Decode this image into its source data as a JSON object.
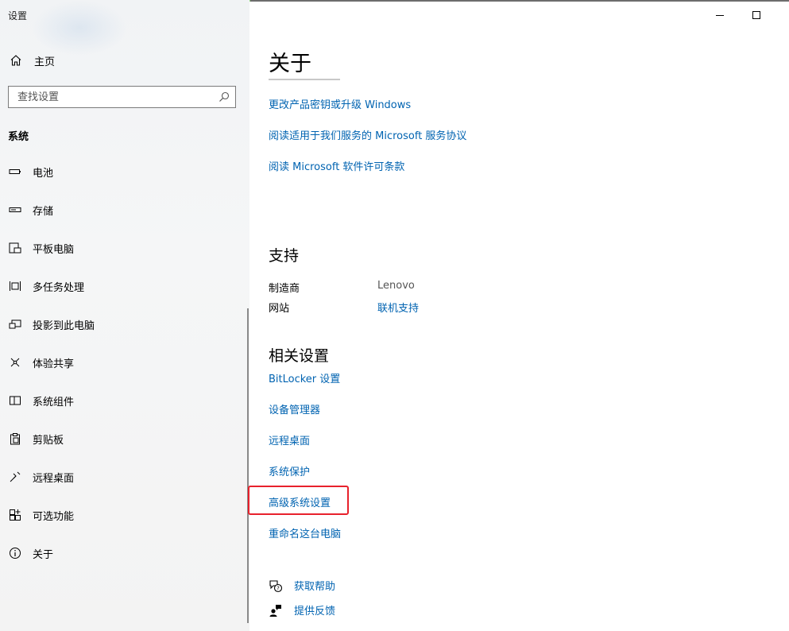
{
  "window": {
    "title": "设置"
  },
  "sidebar": {
    "home_label": "主页",
    "search_placeholder": "查找设置",
    "section_label": "系统",
    "items": [
      {
        "label": "电池",
        "icon": "battery-icon"
      },
      {
        "label": "存储",
        "icon": "storage-icon"
      },
      {
        "label": "平板电脑",
        "icon": "tablet-icon"
      },
      {
        "label": "多任务处理",
        "icon": "multitasking-icon"
      },
      {
        "label": "投影到此电脑",
        "icon": "project-icon"
      },
      {
        "label": "体验共享",
        "icon": "shared-experiences-icon"
      },
      {
        "label": "系统组件",
        "icon": "system-components-icon"
      },
      {
        "label": "剪贴板",
        "icon": "clipboard-icon"
      },
      {
        "label": "远程桌面",
        "icon": "remote-desktop-icon"
      },
      {
        "label": "可选功能",
        "icon": "optional-features-icon"
      },
      {
        "label": "关于",
        "icon": "info-icon"
      }
    ]
  },
  "main": {
    "title": "关于",
    "top_links": [
      "更改产品密钥或升级 Windows",
      "阅读适用于我们服务的 Microsoft 服务协议",
      "阅读 Microsoft 软件许可条款"
    ],
    "support": {
      "heading": "支持",
      "manufacturer_label": "制造商",
      "manufacturer_value": "Lenovo",
      "website_label": "网站",
      "website_value": "联机支持"
    },
    "related": {
      "heading": "相关设置",
      "links": [
        "BitLocker 设置",
        "设备管理器",
        "远程桌面",
        "系统保护",
        "高级系统设置",
        "重命名这台电脑"
      ]
    },
    "help": {
      "get_help": "获取帮助",
      "feedback": "提供反馈"
    }
  },
  "colors": {
    "link": "#0063b1",
    "highlight": "#e8212c"
  }
}
